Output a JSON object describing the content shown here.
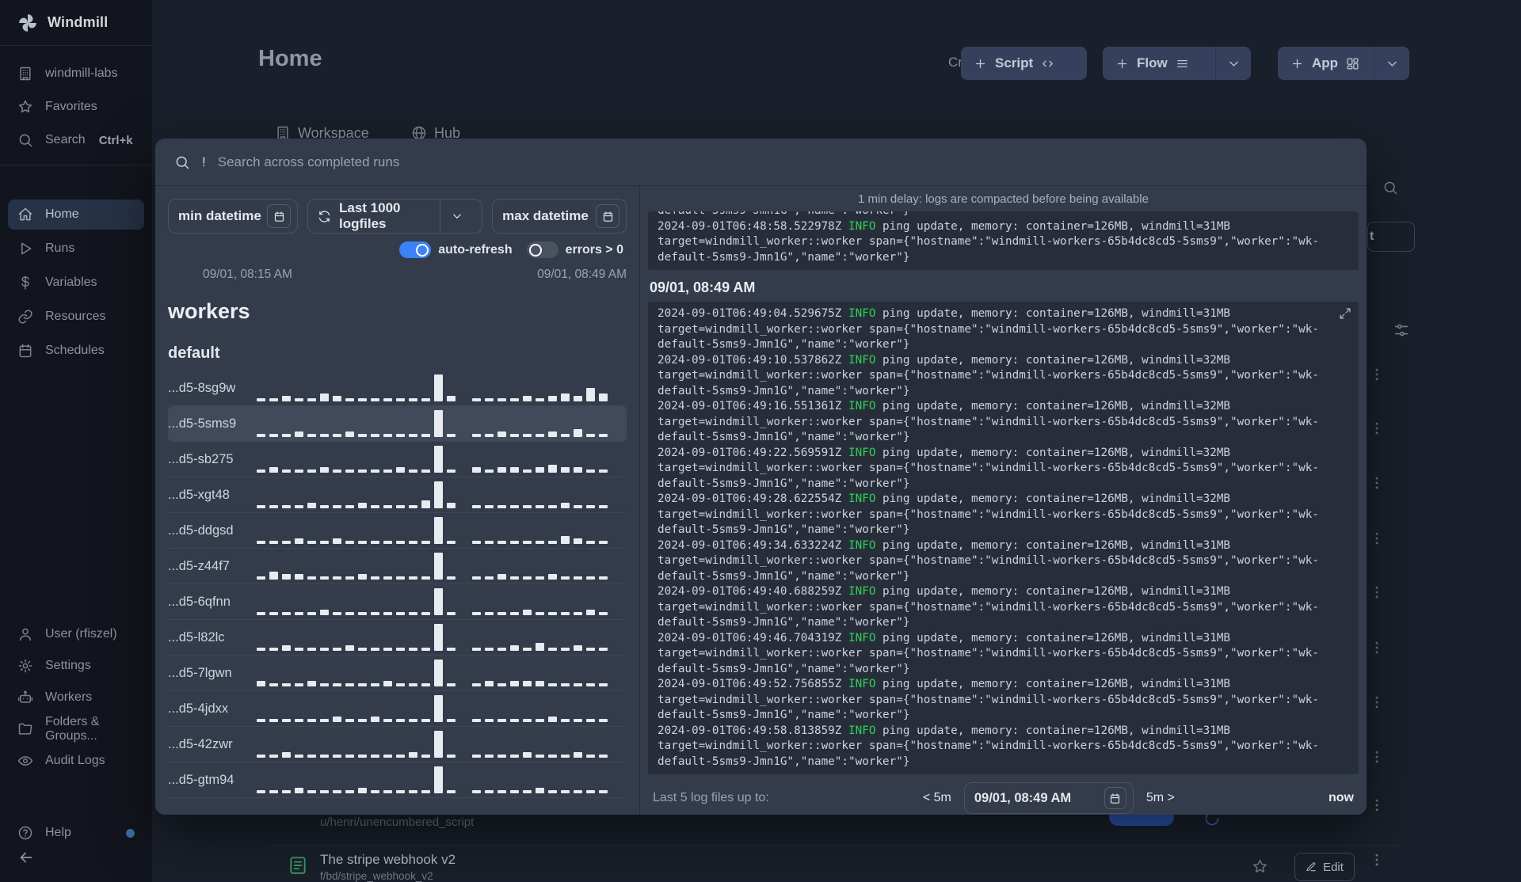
{
  "app": {
    "name": "Windmill"
  },
  "sidebar": {
    "sections": {
      "top": [
        {
          "icon": "building-icon",
          "label": "windmill-labs"
        },
        {
          "icon": "star-icon",
          "label": "Favorites"
        },
        {
          "icon": "search-icon",
          "label": "Search",
          "kbd": "Ctrl+k"
        }
      ],
      "main": [
        {
          "icon": "home-icon",
          "label": "Home",
          "active": true
        },
        {
          "icon": "play-icon",
          "label": "Runs"
        },
        {
          "icon": "dollar-icon",
          "label": "Variables"
        },
        {
          "icon": "link-icon",
          "label": "Resources"
        },
        {
          "icon": "calendar-icon",
          "label": "Schedules"
        }
      ],
      "bottom": [
        {
          "icon": "user-icon",
          "label": "User (rfiszel)"
        },
        {
          "icon": "gear-icon",
          "label": "Settings"
        },
        {
          "icon": "robot-icon",
          "label": "Workers"
        },
        {
          "icon": "folder-icon",
          "label": "Folders & Groups..."
        },
        {
          "icon": "eye-icon",
          "label": "Audit Logs"
        }
      ],
      "help": [
        {
          "icon": "help-icon",
          "label": "Help",
          "dot": true
        }
      ]
    }
  },
  "header": {
    "title": "Home",
    "create_label": "Create a",
    "script_label": "Script",
    "flow_label": "Flow",
    "app_label": "App"
  },
  "tabs": [
    {
      "icon": "building-icon",
      "label": "Workspace"
    },
    {
      "icon": "globe-icon",
      "label": "Hub"
    }
  ],
  "modal": {
    "search": {
      "prefix": "!",
      "placeholder": "Search across completed runs"
    },
    "filters": {
      "min": "min datetime",
      "logfiles": "Last 1000 logfiles",
      "max": "max datetime"
    },
    "toggles": [
      {
        "label": "auto-refresh",
        "on": true
      },
      {
        "label": "errors > 0",
        "on": false
      }
    ],
    "range": {
      "start": "09/01, 08:15 AM",
      "end": "09/01, 08:49 AM"
    },
    "workers": {
      "title": "workers",
      "group": "default",
      "rows": [
        {
          "name": "...d5-8sg9w",
          "highlight": false,
          "bars": [
            1,
            1,
            2,
            1,
            1,
            3,
            2,
            1,
            1,
            1,
            1,
            1,
            1,
            1,
            10,
            2,
            0,
            1,
            1,
            1,
            1,
            2,
            1,
            2,
            3,
            2,
            5,
            3
          ]
        },
        {
          "name": "...d5-5sms9",
          "highlight": true,
          "bars": [
            1,
            1,
            1,
            2,
            1,
            1,
            1,
            2,
            1,
            1,
            1,
            1,
            1,
            1,
            10,
            1,
            0,
            1,
            1,
            2,
            1,
            1,
            1,
            2,
            1,
            3,
            1,
            1
          ]
        },
        {
          "name": "...d5-sb275",
          "highlight": false,
          "bars": [
            1,
            2,
            1,
            1,
            1,
            2,
            1,
            1,
            1,
            1,
            1,
            2,
            1,
            1,
            10,
            1,
            0,
            2,
            1,
            2,
            2,
            1,
            2,
            3,
            2,
            2,
            1,
            1
          ]
        },
        {
          "name": "...d5-xgt48",
          "highlight": false,
          "bars": [
            1,
            1,
            1,
            1,
            2,
            1,
            1,
            1,
            2,
            1,
            1,
            1,
            1,
            3,
            10,
            2,
            0,
            1,
            1,
            1,
            1,
            1,
            1,
            1,
            2,
            1,
            1,
            1
          ]
        },
        {
          "name": "...d5-ddgsd",
          "highlight": false,
          "bars": [
            1,
            1,
            1,
            2,
            1,
            1,
            2,
            1,
            1,
            1,
            1,
            1,
            1,
            1,
            10,
            1,
            0,
            1,
            1,
            1,
            1,
            1,
            1,
            1,
            3,
            2,
            1,
            1
          ]
        },
        {
          "name": "...d5-z44f7",
          "highlight": false,
          "bars": [
            1,
            3,
            2,
            2,
            1,
            1,
            1,
            1,
            2,
            1,
            1,
            1,
            1,
            1,
            10,
            1,
            0,
            1,
            1,
            2,
            1,
            1,
            1,
            2,
            1,
            1,
            1,
            1
          ]
        },
        {
          "name": "...d5-6qfnn",
          "highlight": false,
          "bars": [
            1,
            1,
            1,
            1,
            1,
            2,
            1,
            1,
            1,
            1,
            1,
            1,
            1,
            1,
            10,
            1,
            0,
            1,
            1,
            1,
            1,
            2,
            1,
            1,
            1,
            1,
            2,
            1
          ]
        },
        {
          "name": "...d5-l82lc",
          "highlight": false,
          "bars": [
            1,
            1,
            2,
            1,
            1,
            1,
            1,
            2,
            1,
            1,
            1,
            1,
            1,
            1,
            10,
            1,
            0,
            1,
            1,
            1,
            2,
            1,
            3,
            1,
            1,
            2,
            1,
            1
          ]
        },
        {
          "name": "...d5-7lgwn",
          "highlight": false,
          "bars": [
            2,
            1,
            1,
            1,
            2,
            1,
            1,
            1,
            1,
            1,
            2,
            1,
            1,
            1,
            10,
            1,
            0,
            1,
            2,
            1,
            2,
            2,
            2,
            1,
            1,
            1,
            1,
            1
          ]
        },
        {
          "name": "...d5-4jdxx",
          "highlight": false,
          "bars": [
            1,
            1,
            1,
            1,
            1,
            1,
            2,
            1,
            1,
            2,
            1,
            1,
            1,
            1,
            10,
            1,
            0,
            1,
            1,
            1,
            1,
            1,
            1,
            2,
            1,
            1,
            1,
            1
          ]
        },
        {
          "name": "...d5-42zwr",
          "highlight": false,
          "bars": [
            1,
            1,
            2,
            1,
            1,
            1,
            1,
            1,
            1,
            1,
            1,
            1,
            2,
            1,
            10,
            1,
            0,
            1,
            1,
            1,
            1,
            2,
            1,
            1,
            1,
            2,
            1,
            1
          ]
        },
        {
          "name": "...d5-gtm94",
          "highlight": false,
          "bars": [
            1,
            1,
            1,
            2,
            1,
            1,
            1,
            1,
            2,
            1,
            1,
            1,
            1,
            1,
            10,
            1,
            0,
            1,
            1,
            1,
            1,
            1,
            2,
            1,
            1,
            1,
            1,
            1
          ]
        }
      ]
    },
    "logs": {
      "notice": "1 min delay: logs are compacted before being available",
      "section": "09/01, 08:49 AM",
      "wrap_lines": [
        "target=windmill_worker::worker span={\"hostname\":\"windmill-workers-65b4dc8cd5-5sms9\",\"worker\":\"wk-",
        "default-5sms9-Jmn1G\",\"name\":\"worker\"}"
      ],
      "box1": {
        "clipped_line": "default-5sms9-Jmn1G\",\"name\":\"worker\"}",
        "entries": [
          {
            "ts": "2024-09-01T06:48:58.522978Z",
            "level": "INFO",
            "msg": "ping update, memory: container=126MB, windmill=31MB"
          }
        ]
      },
      "box2": {
        "entries": [
          {
            "ts": "2024-09-01T06:49:04.529675Z",
            "level": "INFO",
            "msg": "ping update, memory: container=126MB, windmill=31MB"
          },
          {
            "ts": "2024-09-01T06:49:10.537862Z",
            "level": "INFO",
            "msg": "ping update, memory: container=126MB, windmill=32MB"
          },
          {
            "ts": "2024-09-01T06:49:16.551361Z",
            "level": "INFO",
            "msg": "ping update, memory: container=126MB, windmill=32MB"
          },
          {
            "ts": "2024-09-01T06:49:22.569591Z",
            "level": "INFO",
            "msg": "ping update, memory: container=126MB, windmill=32MB"
          },
          {
            "ts": "2024-09-01T06:49:28.622554Z",
            "level": "INFO",
            "msg": "ping update, memory: container=126MB, windmill=32MB"
          },
          {
            "ts": "2024-09-01T06:49:34.633224Z",
            "level": "INFO",
            "msg": "ping update, memory: container=126MB, windmill=31MB"
          },
          {
            "ts": "2024-09-01T06:49:40.688259Z",
            "level": "INFO",
            "msg": "ping update, memory: container=126MB, windmill=31MB"
          },
          {
            "ts": "2024-09-01T06:49:46.704319Z",
            "level": "INFO",
            "msg": "ping update, memory: container=126MB, windmill=31MB"
          },
          {
            "ts": "2024-09-01T06:49:52.756855Z",
            "level": "INFO",
            "msg": "ping update, memory: container=126MB, windmill=31MB"
          },
          {
            "ts": "2024-09-01T06:49:58.813859Z",
            "level": "INFO",
            "msg": "ping update, memory: container=126MB, windmill=31MB"
          }
        ]
      },
      "footer": {
        "label": "Last 5 log files up to:",
        "back": "< 5m",
        "datetime": "09/01, 08:49 AM",
        "forward": "5m >",
        "now": "now"
      }
    }
  },
  "background": {
    "partial_row": {
      "path": "u/henri/unencumbered_script"
    },
    "script_row": {
      "title": "The stripe webhook v2",
      "path": "f/bd/stripe_webhook_v2",
      "edit_label": "Edit"
    },
    "chip_fragment": "t",
    "row_menu_ys": [
      473,
      541,
      610,
      680,
      748,
      818,
      887,
      956,
      1017,
      1086
    ]
  },
  "colors": {
    "accent_blue": "#3b82f6",
    "info_green": "#2fd157"
  }
}
